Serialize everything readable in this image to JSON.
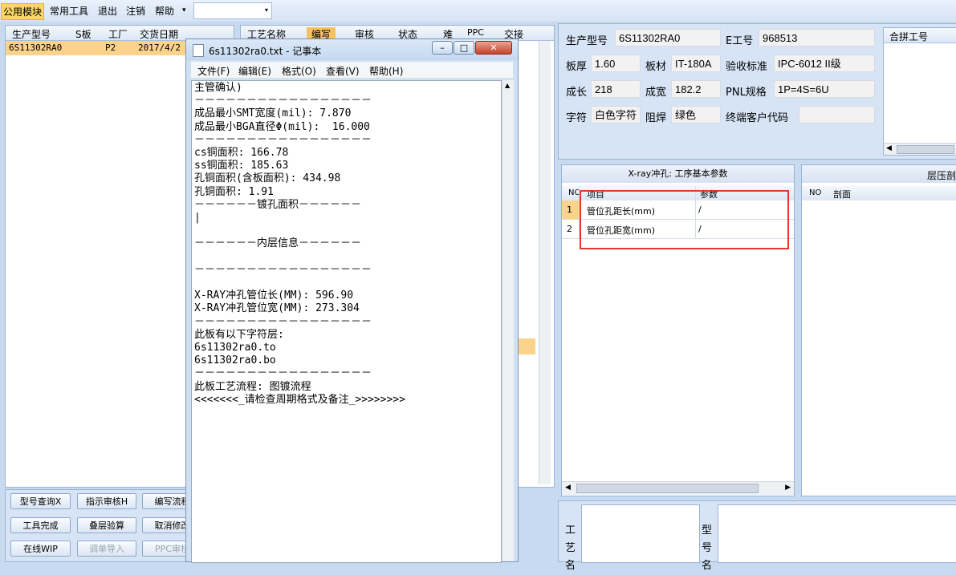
{
  "menubar": {
    "items": [
      "公用模块",
      "常用工具",
      "退出",
      "注销",
      "帮助"
    ],
    "dropdown_arrow": "▾",
    "combo_value": ""
  },
  "order_list": {
    "columns": [
      "生产型号",
      "S板",
      "工厂",
      "交货日期"
    ],
    "rows": [
      {
        "model": "6S11302RA0",
        "factory": "P2",
        "date": "2017/4/2"
      }
    ]
  },
  "process_list": {
    "columns": [
      "工艺名称",
      "编写",
      "审核",
      "状态",
      "难",
      "PPC",
      "交接"
    ]
  },
  "buttons": {
    "row1": [
      "型号查询X",
      "指示审核H",
      "编写流程"
    ],
    "row2": [
      "工具完成",
      "叠层验算",
      "取消修改"
    ],
    "row3": [
      "在线WIP",
      "调单导入",
      "PPC审核"
    ]
  },
  "notepad": {
    "title": "6s11302ra0.txt - 记事本",
    "menu": [
      "文件(F)",
      "编辑(E)",
      "格式(O)",
      "查看(V)",
      "帮助(H)"
    ],
    "lines": [
      "主管确认)",
      "－－－－－－－－－－－－－－－－－",
      "成品最小SMT宽度(mil): 7.870",
      "成品最小BGA直径Φ(mil):  16.000",
      "－－－－－－－－－－－－－－－－－",
      "cs铜面积: 166.78",
      "ss铜面积: 185.63",
      "孔铜面积(含板面积): 434.98",
      "孔铜面积: 1.91",
      "－－－－－－镀孔面积－－－－－－",
      "|",
      "",
      "－－－－－－内层信息－－－－－－",
      "",
      "－－－－－－－－－－－－－－－－－",
      "",
      "X-RAY冲孔管位长(MM): 596.90",
      "X-RAY冲孔管位宽(MM): 273.304",
      "－－－－－－－－－－－－－－－－－",
      "此板有以下字符层:",
      "6s11302ra0.to",
      "6s11302ra0.bo",
      "－－－－－－－－－－－－－－－－－",
      "此板工艺流程: 图镀流程",
      "<<<<<<<_请检查周期格式及备注_>>>>>>>>"
    ]
  },
  "info_form": {
    "model_label": "生产型号",
    "model_value": "6S11302RA0",
    "eno_label": "E工号",
    "eno_value": "968513",
    "thick_label": "板厚",
    "thick_value": "1.60",
    "material_label": "板材",
    "material_value": "IT-180A",
    "std_label": "验收标准",
    "std_value": "IPC-6012 II级",
    "len_label": "成长",
    "len_value": "218",
    "wid_label": "成宽",
    "wid_value": "182.2",
    "pnl_label": "PNL规格",
    "pnl_value": "1P=4S=6U",
    "char_label": "字符",
    "char_value": "白色字符",
    "mask_label": "阻焊",
    "mask_value": "绿色",
    "cust_label": "终端客户代码",
    "cust_value": ""
  },
  "merge_panel": {
    "header": "合拼工号"
  },
  "xray_panel": {
    "title": "X-ray冲孔: 工序基本参数",
    "columns": [
      "NO",
      "项目",
      "参数"
    ],
    "rows": [
      {
        "no": "1",
        "item": "管位孔距长(mm)",
        "param": "/"
      },
      {
        "no": "2",
        "item": "管位孔距宽(mm)",
        "param": "/"
      }
    ],
    "highlight_color": "#e23a2a"
  },
  "layer_panel": {
    "title": "层压剖",
    "columns": [
      "NO",
      "剖面"
    ]
  },
  "bottom_labels": {
    "left": "工艺名",
    "right": "型号名"
  }
}
